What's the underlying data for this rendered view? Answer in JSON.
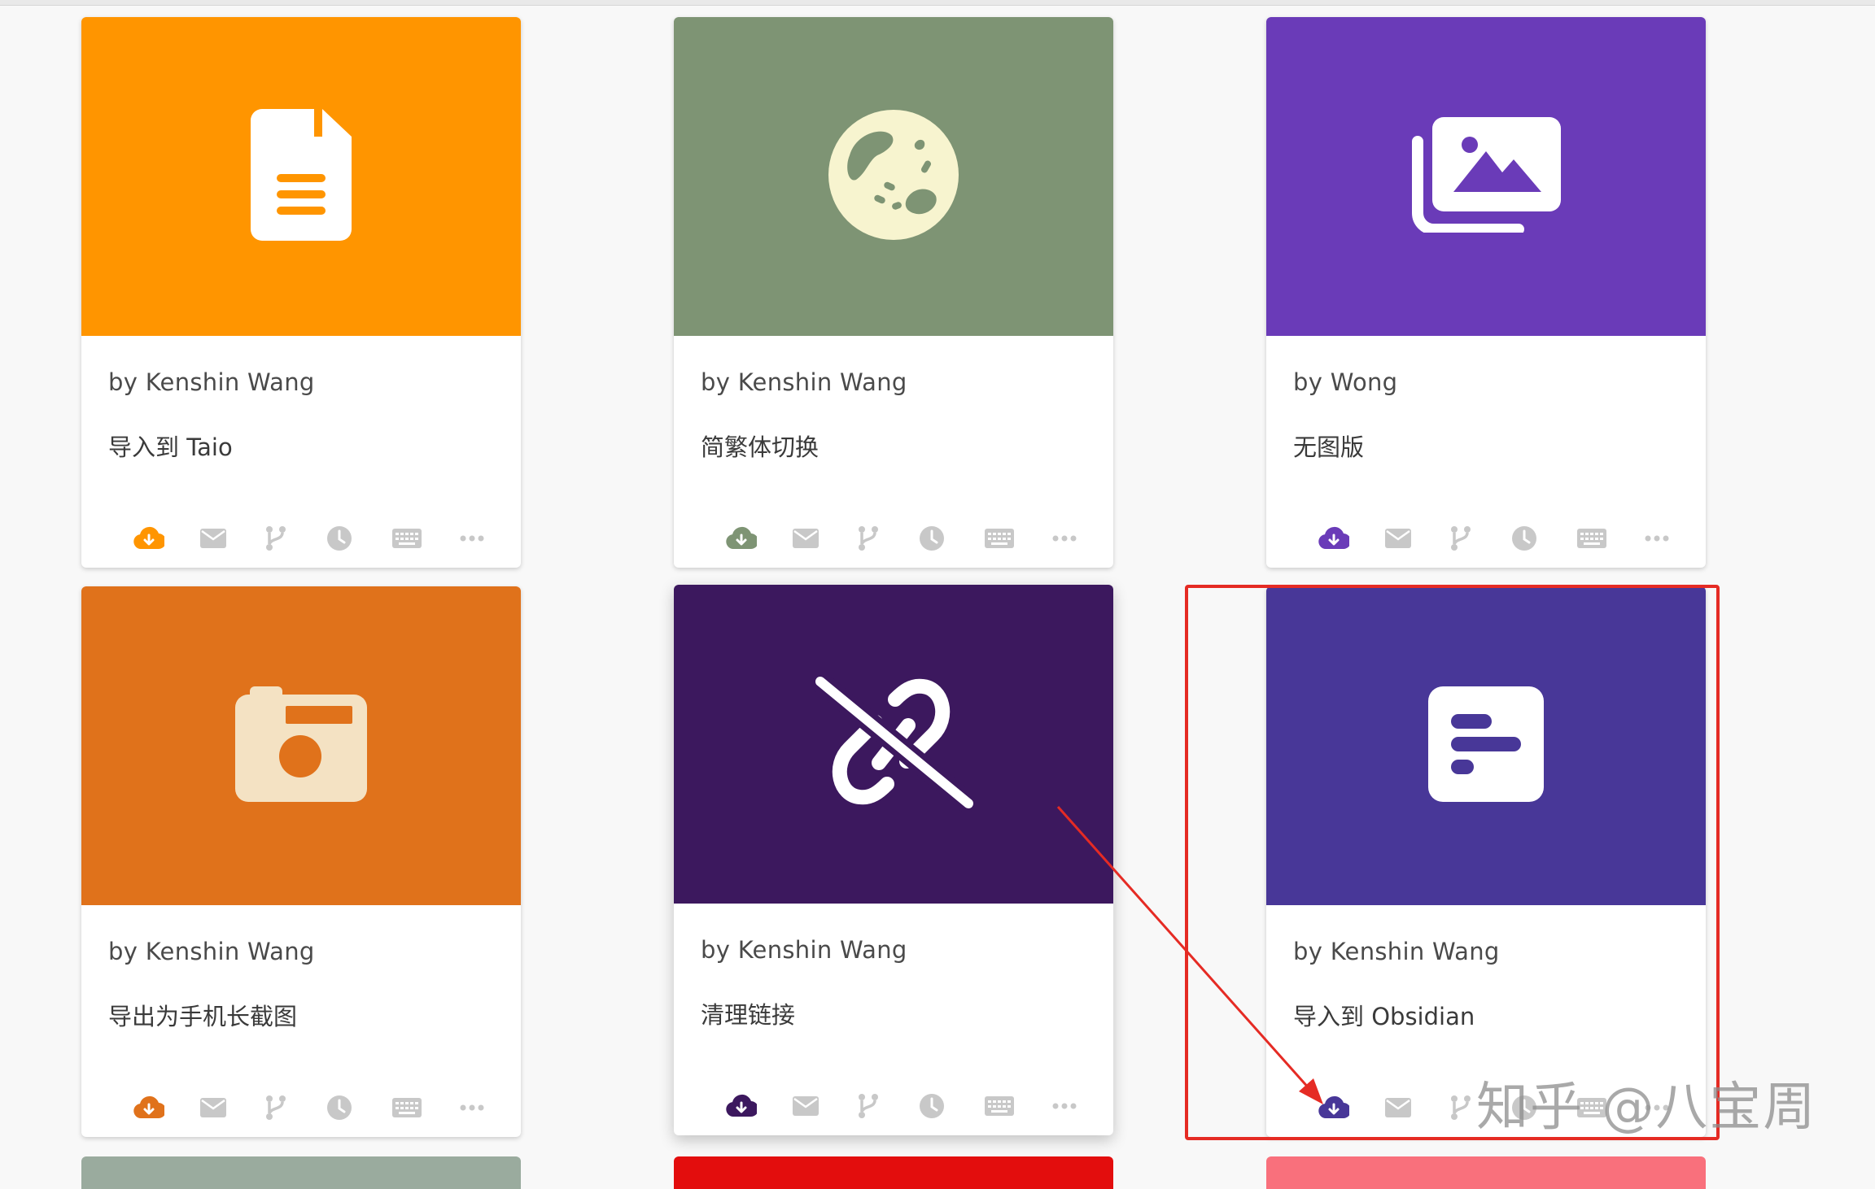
{
  "cards": [
    {
      "author": "by Kenshin Wang",
      "title": "导入到 Taio",
      "icon": "document-icon",
      "color": "#ff9500",
      "accent": "#ff9500"
    },
    {
      "author": "by Kenshin Wang",
      "title": "简繁体切换",
      "icon": "globe-icon",
      "color": "#7e9474",
      "accent": "#7e9474"
    },
    {
      "author": "by Wong",
      "title": "无图版",
      "icon": "photo-gallery-icon",
      "color": "#6a3bb8",
      "accent": "#6a3bb8"
    },
    {
      "author": "by Kenshin Wang",
      "title": "导出为手机长截图",
      "icon": "camera-icon",
      "color": "#e0721b",
      "accent": "#e0721b"
    },
    {
      "author": "by Kenshin Wang",
      "title": "清理链接",
      "icon": "unlink-icon",
      "color": "#3c185e",
      "accent": "#3c185e"
    },
    {
      "author": "by Kenshin Wang",
      "title": "导入到 Obsidian",
      "icon": "text-block-icon",
      "color": "#483798",
      "accent": "#483798"
    }
  ],
  "card_actions": [
    "install-icon",
    "mail-icon",
    "branch-icon",
    "clock-icon",
    "keyboard-icon",
    "more-icon"
  ],
  "partial_row_colors": [
    "#9aab9e",
    "#e30d0d",
    "#f9707c"
  ],
  "annotation": {
    "box_color": "#e52b24",
    "arrow_color": "#e52b24"
  },
  "watermark": "知乎 @八宝周"
}
